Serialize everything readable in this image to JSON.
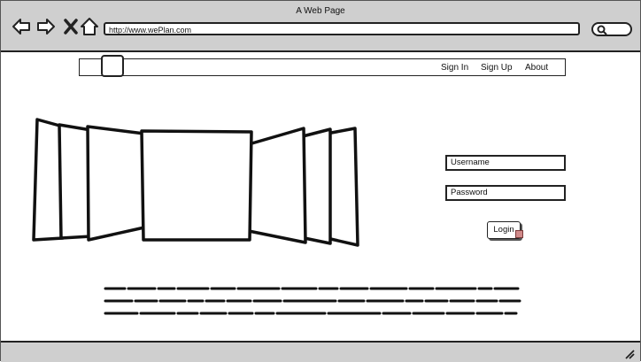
{
  "window": {
    "title": "A Web Page"
  },
  "address_bar": {
    "url": "http://www.wePlan.com"
  },
  "nav_icons": [
    "back-arrow-icon",
    "forward-arrow-icon",
    "close-x-icon",
    "home-icon"
  ],
  "search_icon": "search-icon",
  "nav_links": [
    {
      "label": "Sign In"
    },
    {
      "label": "Sign Up"
    },
    {
      "label": "About"
    }
  ],
  "login_form": {
    "username_placeholder": "Username",
    "password_placeholder": "Password",
    "submit_label": "Login"
  },
  "colors": {
    "chrome": "#cfcfcf",
    "stroke": "#222222",
    "badge": "#d08a8a"
  }
}
